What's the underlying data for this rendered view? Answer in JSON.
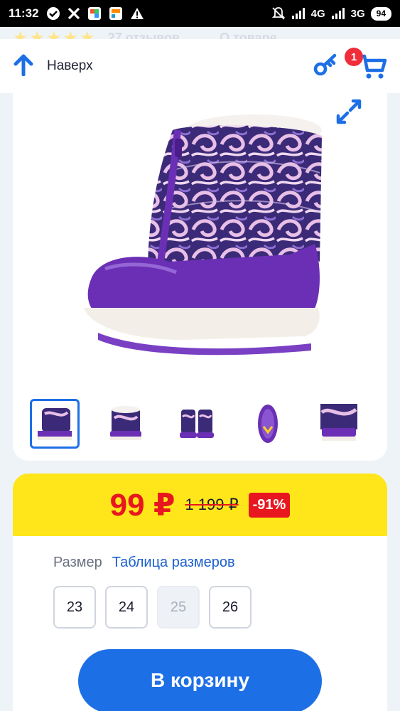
{
  "status_bar": {
    "time": "11:32",
    "network_1": "4G",
    "network_2": "3G",
    "battery": "94"
  },
  "ghost_row": {
    "reviews": "27 отзывов",
    "about": "О товаре"
  },
  "header": {
    "back_label": "Наверх",
    "cart_count": "1"
  },
  "gallery": {
    "thumb_count": 6,
    "active_index": 0
  },
  "price": {
    "current": "99 ₽",
    "old": "1 199 ₽",
    "discount": "-91%"
  },
  "size_section": {
    "label": "Размер",
    "table_link": "Таблица размеров",
    "sizes": [
      {
        "value": "23",
        "available": true
      },
      {
        "value": "24",
        "available": true
      },
      {
        "value": "25",
        "available": false
      },
      {
        "value": "26",
        "available": true
      }
    ]
  },
  "cta": {
    "label": "В корзину"
  },
  "colors": {
    "accent_blue": "#1d6fe6",
    "price_yellow": "#ffe61a",
    "price_red": "#e8171f",
    "boot_purple": "#6b2fb5"
  }
}
